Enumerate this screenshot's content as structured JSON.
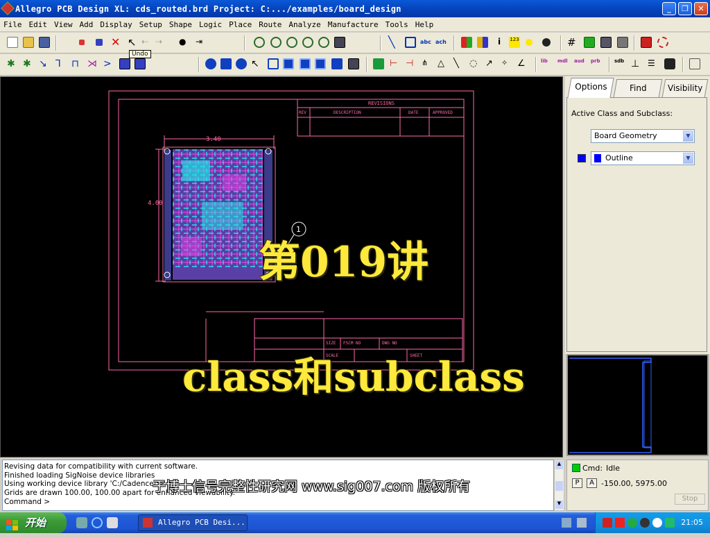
{
  "window": {
    "title": "Allegro PCB Design XL: cds_routed.brd  Project: C:.../examples/board_design",
    "controls": {
      "minimize": "_",
      "maximize": "❐",
      "close": "✕"
    }
  },
  "menu": [
    "File",
    "Edit",
    "View",
    "Add",
    "Display",
    "Setup",
    "Shape",
    "Logic",
    "Place",
    "Route",
    "Analyze",
    "Manufacture",
    "Tools",
    "Help"
  ],
  "toolbar": {
    "tooltip": "Undo"
  },
  "overlay": {
    "title": "第019讲",
    "subtitle": "class和subclass"
  },
  "drawing": {
    "revisions_title": "REVISIONS",
    "rev_headers": [
      "REV",
      "DESCRIPTION",
      "DATE",
      "APPROVED"
    ],
    "dim_width": "3.40",
    "dim_height": "4.00",
    "callout": "1",
    "titleblock": {
      "size": "SIZE",
      "fscm": "FSCM NO",
      "dwg": "DWG NO",
      "scale": "SCALE",
      "sheet": "SHEET"
    }
  },
  "panel": {
    "tabs": [
      "Options",
      "Find",
      "Visibility"
    ],
    "active_label": "Active Class and Subclass:",
    "class_value": "Board Geometry",
    "subclass_value": "Outline",
    "subclass_color": "#0000ff"
  },
  "console": {
    "lines": [
      "Revising data for compatibility with current software.",
      "Finished loading SigNoise device libraries",
      "Using working device library 'C:/Cadence/SP",
      "Grids are drawn 100.00, 100.00 apart for enhanced viewability.",
      "Command >"
    ]
  },
  "watermark": "于博士信号完整性研究网 www.sig007.com 版权所有",
  "status": {
    "cmd_label": "Cmd:",
    "cmd_value": "Idle",
    "p_btn": "P",
    "a_btn": "A",
    "coords": "-150.00, 5975.00",
    "stop": "Stop",
    "indicator_color": "#00cc00"
  },
  "taskbar": {
    "start": "开始",
    "task": "Allegro PCB Desi...",
    "clock": "21:05"
  },
  "colors": {
    "outline": "#ff6aa8",
    "pcb_bg": "#3b3b8a",
    "cyan": "#24e0e6",
    "magenta": "#e040e0",
    "overlay": "#ffe93c"
  }
}
